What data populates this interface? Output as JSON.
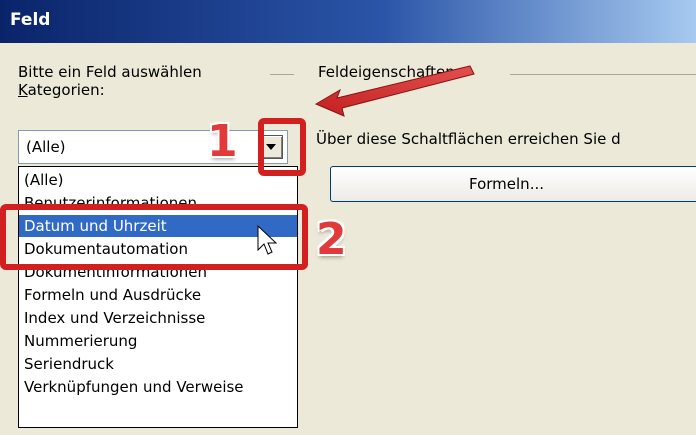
{
  "window": {
    "title": "Feld"
  },
  "left_group": {
    "title": "Bitte ein Feld auswählen",
    "category_label": "Kategorien:",
    "combo_value": "(Alle)",
    "list_items": [
      "(Alle)",
      "Benutzerinformationen",
      "Datum und Uhrzeit",
      "Dokumentautomation",
      "Dokumentinformationen",
      "Formeln und Ausdrücke",
      "Index und Verzeichnisse",
      "Nummerierung",
      "Seriendruck",
      "Verknüpfungen und Verweise"
    ],
    "selected_item": "Datum und Uhrzeit"
  },
  "right_group": {
    "title": "Feldeigenschaften",
    "hint": "Über diese Schaltflächen erreichen Sie d",
    "formula_button": "Formeln..."
  },
  "annotations": {
    "step1": "1",
    "step2": "2",
    "color": "#d22020"
  }
}
